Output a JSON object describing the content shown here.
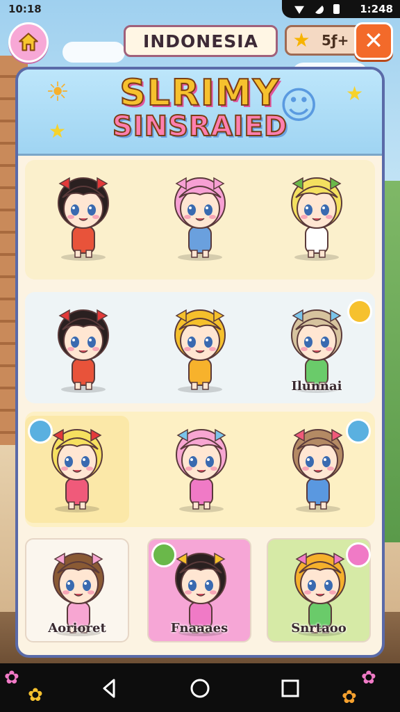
{
  "status_bar": {
    "time_left": "10:18",
    "time_right": "1:248"
  },
  "header": {
    "title": "INDONESIA",
    "coins": "5ƒ+"
  },
  "banner": {
    "logo_line1": "SLRIMY",
    "logo_line2": "SINSRAIED"
  },
  "grid": {
    "rows": [
      {
        "background": "#fbf0cc",
        "cells": [
          {
            "hair": "#2a2020",
            "outfit": "#e8533a",
            "bow": "#e23a3a",
            "label": ""
          },
          {
            "hair": "#f7a0d4",
            "outfit": "#6aa0de",
            "bow": "#f7a0d4",
            "label": ""
          },
          {
            "hair": "#f4e060",
            "outfit": "#ffffff",
            "bow": "#6ab84a",
            "label": ""
          }
        ]
      },
      {
        "background": "#eef4f6",
        "cells": [
          {
            "hair": "#2a2020",
            "outfit": "#e8533a",
            "bow": "#e23a3a",
            "label": ""
          },
          {
            "hair": "#f5c02c",
            "outfit": "#f7b22c",
            "bow": "#f5c02c",
            "label": ""
          },
          {
            "hair": "#d6c39e",
            "outfit": "#6acb6a",
            "bow": "#7ac4ea",
            "label": "Ilunnai"
          }
        ]
      },
      {
        "background": "#fdf0c4",
        "cells": [
          {
            "hair": "#f6e060",
            "outfit": "#f05a7a",
            "bow": "#e23a3a",
            "label": ""
          },
          {
            "hair": "#f7a6d2",
            "outfit": "#f07ac6",
            "bow": "#7ac4ea",
            "label": ""
          },
          {
            "hair": "#b48a64",
            "outfit": "#5a98e0",
            "bow": "#f05a7a",
            "label": ""
          }
        ]
      },
      {
        "background": "transparent",
        "cells": [
          {
            "hair": "#8a5a34",
            "outfit": "#f7a6d2",
            "bow": "#f7a6d2",
            "label": "Aorioret"
          },
          {
            "hair": "#2a2020",
            "outfit": "#f07ac6",
            "bow": "#f5c02c",
            "label": "Fnaaaes"
          },
          {
            "hair": "#f5b02c",
            "outfit": "#6acb6a",
            "bow": "#f07ac6",
            "label": "Snrtaoo"
          }
        ]
      }
    ]
  },
  "colors": {
    "panel_border": "#5a6aa8",
    "close": "#f36a2a",
    "home": "#f7a8d6"
  },
  "icons": {
    "home": "home-icon",
    "close": "close-icon",
    "coin": "star-coin-icon"
  }
}
